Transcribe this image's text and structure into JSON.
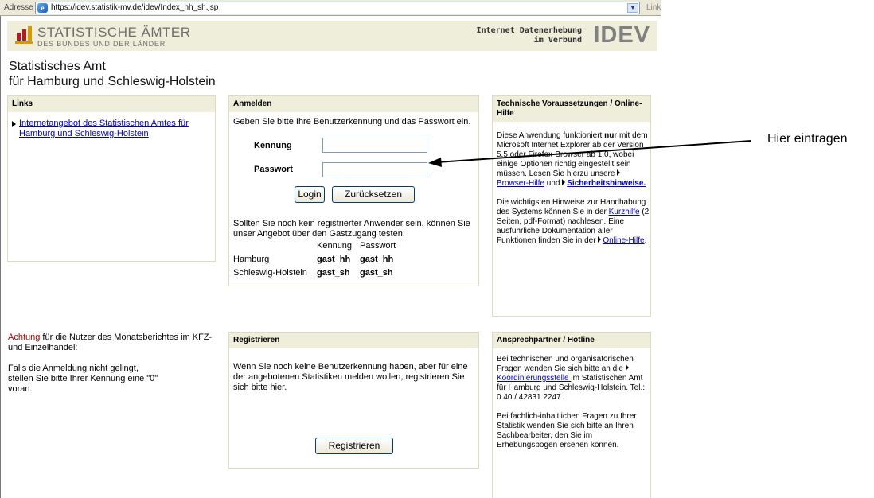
{
  "browser": {
    "address_label": "Adresse",
    "url": "https://idev.statistik-mv.de/idev/Index_hh_sh.jsp",
    "links_label": "Link"
  },
  "header": {
    "logo_line1": "STATISTISCHE ÄMTER",
    "logo_line2": "DES BUNDES UND DER LÄNDER",
    "idev_line1": "Internet Datenerhebung",
    "idev_line2": "im Verbund",
    "idev_logo": "IDEV"
  },
  "org_title": {
    "line1": "Statistisches Amt",
    "line2": "für Hamburg und Schleswig-Holstein"
  },
  "links_panel": {
    "heading": "Links",
    "item": "Internetangebot des Statistischen Amtes für Hamburg und Schleswig-Holstein"
  },
  "login_panel": {
    "heading": "Anmelden",
    "intro": "Geben Sie bitte Ihre Benutzerkennung und das Passwort ein.",
    "kennung_label": "Kennung",
    "passwort_label": "Passwort",
    "kennung_value": "",
    "passwort_value": "",
    "login_button": "Login",
    "reset_button": "Zurücksetzen",
    "guest_text": "Sollten Sie noch kein registrierter Anwender sein, können Sie unser Angebot über den Gastzugang testen:",
    "col_kennung": "Kennung",
    "col_passwort": "Passwort",
    "rows": [
      {
        "region": "Hamburg",
        "kennung": "gast_hh",
        "passwort": "gast_hh"
      },
      {
        "region": "Schleswig-Holstein",
        "kennung": "gast_sh",
        "passwort": "gast_sh"
      }
    ]
  },
  "tech_panel": {
    "heading": "Technische Voraussetzungen / Online-Hilfe",
    "p1_a": "Diese Anwendung funktioniert ",
    "p1_bold": "nur",
    "p1_b": " mit dem Microsoft Internet Explorer ab der Version 5.5 oder Firefox-Browser ab 1.0, wobei einige Optionen richtig eingestellt sein müssen. Lesen Sie hierzu unsere ",
    "browser_link": "Browser-Hilfe",
    "p1_c": " und ",
    "security_link": "Sicherheitshinweise.",
    "p2_a": "Die wichtigsten Hinweise zur Handhabung des Systems können Sie in der ",
    "kurz_link": "Kurzhilfe",
    "p2_b": " (2 Seiten, pdf-Format) nachlesen. Eine ausführliche Dokumentation aller Funktionen finden Sie in der ",
    "online_link": "Online-Hilfe",
    "p2_c": "."
  },
  "note": {
    "red": "Achtung",
    "line1": " für die Nutzer des Monatsberichtes im KFZ- und Einzelhandel:",
    "line2": "Falls die Anmeldung nicht gelingt, stellen Sie bitte Ihrer Kennung eine \"0\" voran."
  },
  "register_panel": {
    "heading": "Registrieren",
    "text": "Wenn Sie noch keine Benutzerkennung haben, aber für eine der angebotenen Statistiken melden wollen, registrieren Sie sich bitte hier.",
    "button": "Registrieren"
  },
  "hotline_panel": {
    "heading": "Ansprechpartner / Hotline",
    "p1_a": "Bei technischen und organisatorischen Fragen wenden Sie sich bitte an die ",
    "koord_link": "Koordinierungsstelle ",
    "p1_b": "im Statistischen Amt für Hamburg und Schleswig-Holstein. Tel.: 0 40 / 42831 2247  .",
    "p2": "Bei fachlich-inhaltlichen Fragen zu Ihrer Statistik wenden Sie sich bitte an Ihren Sachbearbeiter, den Sie im Erhebungsbogen ersehen können."
  },
  "annotation": {
    "text": "Hier eintragen"
  },
  "colors": {
    "panel_header": "#eeeedb",
    "link": "#0000cc",
    "warning": "#b30000",
    "logo_red": "#b11c1c"
  }
}
